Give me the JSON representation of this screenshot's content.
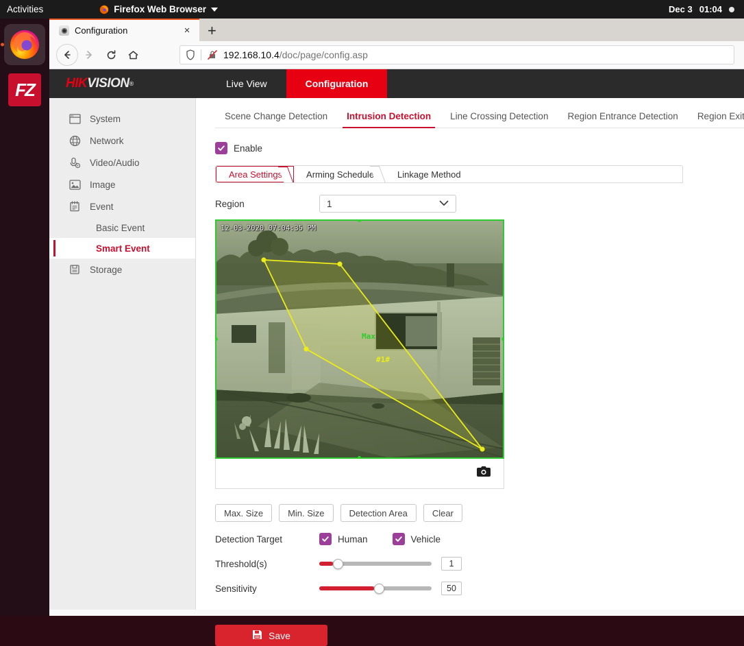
{
  "desktop": {
    "activities": "Activities",
    "app_menu": "Firefox Web Browser",
    "clock_date": "Dec 3",
    "clock_time": "01:04",
    "dock": [
      {
        "name": "firefox",
        "label": "Firefox",
        "active": true
      },
      {
        "name": "filezilla",
        "label": "FZ",
        "active": false
      }
    ]
  },
  "browser": {
    "tab_title": "Configuration",
    "tab_close": "×",
    "new_tab": "+",
    "nav": {
      "back": "←",
      "forward": "→",
      "reload": "↻",
      "home": "⌂"
    },
    "url_host": "192.168.10.4",
    "url_path": "/doc/page/config.asp"
  },
  "hik": {
    "logo_hik": "HIK",
    "logo_vision": "VISION",
    "logo_reg": "®",
    "nav": [
      {
        "label": "Live View",
        "active": false
      },
      {
        "label": "Configuration",
        "active": true
      }
    ],
    "accent_red": "#c8102e",
    "sidebar": [
      {
        "label": "System",
        "icon": "window-icon",
        "type": "item"
      },
      {
        "label": "Network",
        "icon": "globe-icon",
        "type": "item"
      },
      {
        "label": "Video/Audio",
        "icon": "microphone-icon",
        "type": "item"
      },
      {
        "label": "Image",
        "icon": "picture-icon",
        "type": "item"
      },
      {
        "label": "Event",
        "icon": "calendar-icon",
        "type": "item"
      },
      {
        "label": "Basic Event",
        "icon": "",
        "type": "sub",
        "active": false
      },
      {
        "label": "Smart Event",
        "icon": "",
        "type": "sub",
        "active": true
      },
      {
        "label": "Storage",
        "icon": "disk-icon",
        "type": "item"
      }
    ],
    "tabs": [
      {
        "label": "Scene Change Detection",
        "active": false
      },
      {
        "label": "Intrusion Detection",
        "active": true
      },
      {
        "label": "Line Crossing Detection",
        "active": false
      },
      {
        "label": "Region Entrance Detection",
        "active": false
      },
      {
        "label": "Region Exiting Detection",
        "active": false
      }
    ],
    "enable": {
      "label": "Enable",
      "checked": true
    },
    "steps": [
      {
        "label": "Area Settings",
        "active": true
      },
      {
        "label": "Arming Schedule",
        "active": false
      },
      {
        "label": "Linkage Method",
        "active": false
      }
    ],
    "region": {
      "label": "Region",
      "value": "1"
    },
    "video": {
      "timestamp": "12-03-2020 07:04:35 PM",
      "max_label": "Max",
      "region_label": "#1#",
      "border_color": "#2ecb2e",
      "polygon_color": "#ecec18",
      "snapshot_icon": "camera-icon"
    },
    "area_buttons": [
      {
        "label": "Max. Size"
      },
      {
        "label": "Min. Size"
      },
      {
        "label": "Detection Area"
      },
      {
        "label": "Clear"
      }
    ],
    "detection_target": {
      "label": "Detection Target",
      "options": [
        {
          "label": "Human",
          "checked": true
        },
        {
          "label": "Vehicle",
          "checked": true
        }
      ]
    },
    "threshold": {
      "label": "Threshold(s)",
      "value": "1",
      "percent": 7
    },
    "sensitivity": {
      "label": "Sensitivity",
      "value": "50",
      "percent": 50
    },
    "save": {
      "label": "Save",
      "icon": "floppy-icon"
    }
  }
}
